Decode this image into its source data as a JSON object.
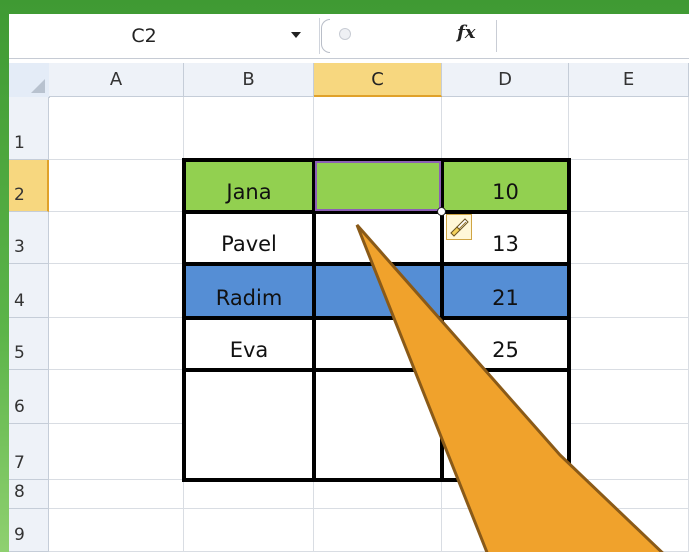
{
  "formula_bar": {
    "name_box": "C2",
    "fx_label": "fx",
    "formula_value": ""
  },
  "columns": [
    "A",
    "B",
    "C",
    "D",
    "E"
  ],
  "rows": [
    "1",
    "2",
    "3",
    "4",
    "5",
    "6",
    "7",
    "8",
    "9"
  ],
  "selected_cell": {
    "column": "C",
    "row": "2"
  },
  "table": [
    {
      "name": "Jana",
      "value": "10",
      "fill": "#92d050"
    },
    {
      "name": "Pavel",
      "value": "13",
      "fill": "#ffffff"
    },
    {
      "name": "Radim",
      "value": "21",
      "fill": "#558ed5"
    },
    {
      "name": "Eva",
      "value": "25",
      "fill": "#ffffff"
    },
    {
      "name": "",
      "value": "",
      "fill": "#ffffff"
    },
    {
      "name": "",
      "value": "",
      "fill": "#ffffff"
    }
  ],
  "colors": {
    "green_fill": "#92d050",
    "blue_fill": "#558ed5",
    "pointer_fill": "#f0a22c",
    "pointer_outline": "#8a5a18",
    "frame_green": "#4aa83a"
  },
  "icons": {
    "name_box_dropdown": "chevron-down-icon",
    "fx": "function-icon",
    "paste_options": "paintbrush-icon",
    "corner": "select-all-icon"
  }
}
